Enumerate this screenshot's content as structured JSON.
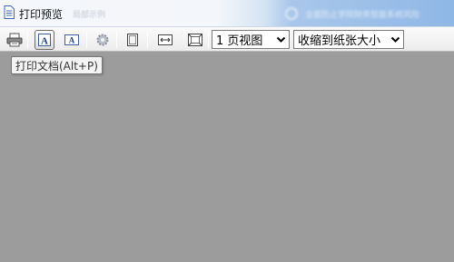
{
  "window": {
    "title": "打印预览",
    "blurred_title_text": "局部示例",
    "banner_text": "全面防止学院财务智能系统风险"
  },
  "toolbar": {
    "buttons": [
      {
        "name": "print-button",
        "icon": "printer-icon"
      },
      {
        "name": "zoom-in-button",
        "icon": "letter-a-large-icon"
      },
      {
        "name": "zoom-out-button",
        "icon": "letter-a-small-icon"
      },
      {
        "name": "page-setup-button",
        "icon": "gear-icon"
      },
      {
        "name": "single-page-button",
        "icon": "page-icon"
      },
      {
        "name": "fit-width-button",
        "icon": "fit-width-icon"
      },
      {
        "name": "fit-page-button",
        "icon": "fit-page-icon"
      }
    ],
    "view_select": {
      "value": "1 页视图"
    },
    "scale_select": {
      "value": "收缩到纸张大小"
    }
  },
  "tooltip": {
    "text": "打印文档(Alt+P)"
  },
  "colors": {
    "workspace": "#9c9c9c",
    "toolbar": "#efefef",
    "title_accent": "#8fb7e6"
  }
}
